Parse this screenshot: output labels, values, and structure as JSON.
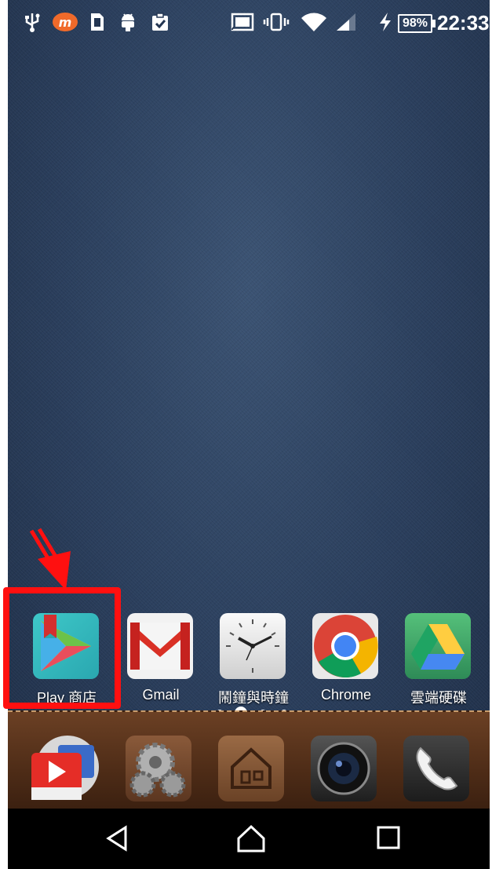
{
  "status_bar": {
    "battery": "98%",
    "time": "22:33",
    "icons": [
      "usb-icon",
      "mobile-app-icon",
      "sim-icon",
      "android-icon",
      "clipboard-check-icon",
      "cast-icon",
      "vibrate-icon",
      "wifi-icon",
      "signal-icon",
      "charging-icon"
    ]
  },
  "home": {
    "apps": [
      {
        "label": "Play 商店",
        "icon": "play-store-icon"
      },
      {
        "label": "Gmail",
        "icon": "gmail-icon"
      },
      {
        "label": "鬧鐘與時鐘",
        "icon": "clock-icon"
      },
      {
        "label": "Chrome",
        "icon": "chrome-icon"
      },
      {
        "label": "雲端硬碟",
        "icon": "drive-icon"
      }
    ],
    "page_indicator": {
      "count": 4,
      "current": 2
    }
  },
  "dock": {
    "items": [
      "video-player-icon",
      "settings-gear-icon",
      "home-launcher-icon",
      "camera-icon",
      "phone-icon"
    ]
  },
  "navigation": {
    "buttons": [
      "back-button",
      "home-button",
      "recents-button"
    ]
  },
  "annotation": {
    "highlight_color": "#ff1010"
  }
}
